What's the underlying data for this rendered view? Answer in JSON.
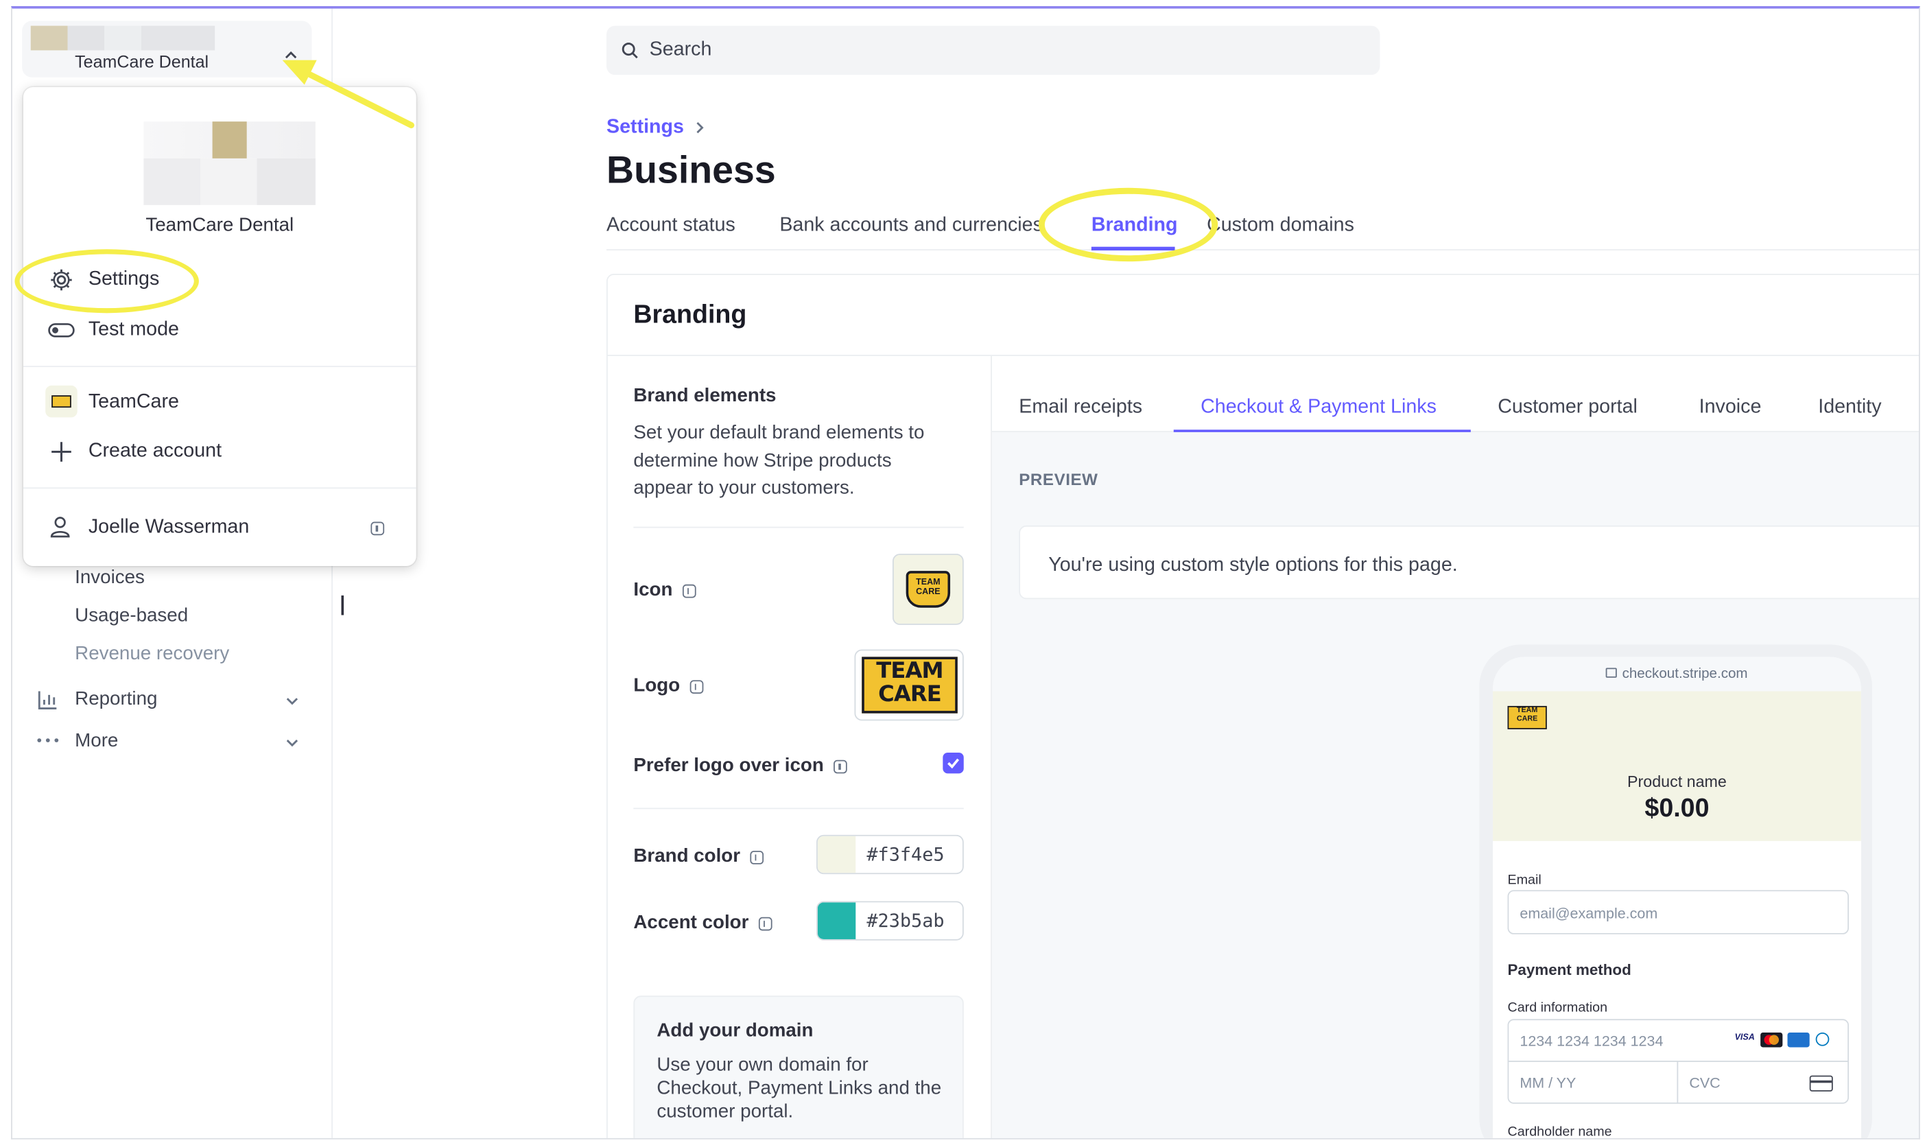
{
  "account": {
    "name": "TeamCare Dental"
  },
  "search": {
    "placeholder": "Search"
  },
  "breadcrumb": {
    "settings": "Settings"
  },
  "page": {
    "title": "Business"
  },
  "tabs": [
    {
      "label": "Account status"
    },
    {
      "label": "Bank accounts and currencies"
    },
    {
      "label": "Branding"
    },
    {
      "label": "Custom domains"
    }
  ],
  "sidebar": {
    "items": [
      {
        "label": "Invoices"
      },
      {
        "label": "Usage-based"
      },
      {
        "label": "Revenue recovery"
      },
      {
        "label": "Reporting"
      },
      {
        "label": "More"
      }
    ]
  },
  "dropdown": {
    "account_name": "TeamCare Dental",
    "settings": "Settings",
    "test_mode": "Test mode",
    "other_account": "TeamCare",
    "create_account": "Create account",
    "user": "Joelle Wasserman"
  },
  "branding": {
    "title": "Branding",
    "brand_elements_title": "Brand elements",
    "brand_elements_desc": "Set your default brand elements to determine how Stripe products appear to your customers.",
    "icon_label": "Icon",
    "logo_label": "Logo",
    "prefer_logo_label": "Prefer logo over icon",
    "prefer_logo_checked": true,
    "brand_color_label": "Brand color",
    "brand_color": "#f3f4e5",
    "accent_color_label": "Accent color",
    "accent_color": "#23b5ab",
    "domain_title": "Add your domain",
    "domain_desc": "Use your own domain for Checkout, Payment Links and the customer portal."
  },
  "subtabs": [
    {
      "label": "Email receipts"
    },
    {
      "label": "Checkout & Payment Links"
    },
    {
      "label": "Customer portal"
    },
    {
      "label": "Invoice"
    },
    {
      "label": "Identity"
    }
  ],
  "preview": {
    "heading": "PREVIEW",
    "notice": "You're using custom style options for this page.",
    "url": "checkout.stripe.com",
    "product_name": "Product name",
    "price": "$0.00",
    "email_label": "Email",
    "email_placeholder": "email@example.com",
    "payment_method": "Payment method",
    "card_info": "Card information",
    "card_placeholder": "1234 1234 1234 1234",
    "expiry_placeholder": "MM / YY",
    "cvc_placeholder": "CVC",
    "cardholder": "Cardholder name"
  },
  "logo_text": {
    "line1": "TEAM",
    "line2": "CARE"
  },
  "colors": {
    "accent_purple": "#635bff",
    "highlight": "#f5ee4a",
    "brand_gold": "#f2c230"
  }
}
